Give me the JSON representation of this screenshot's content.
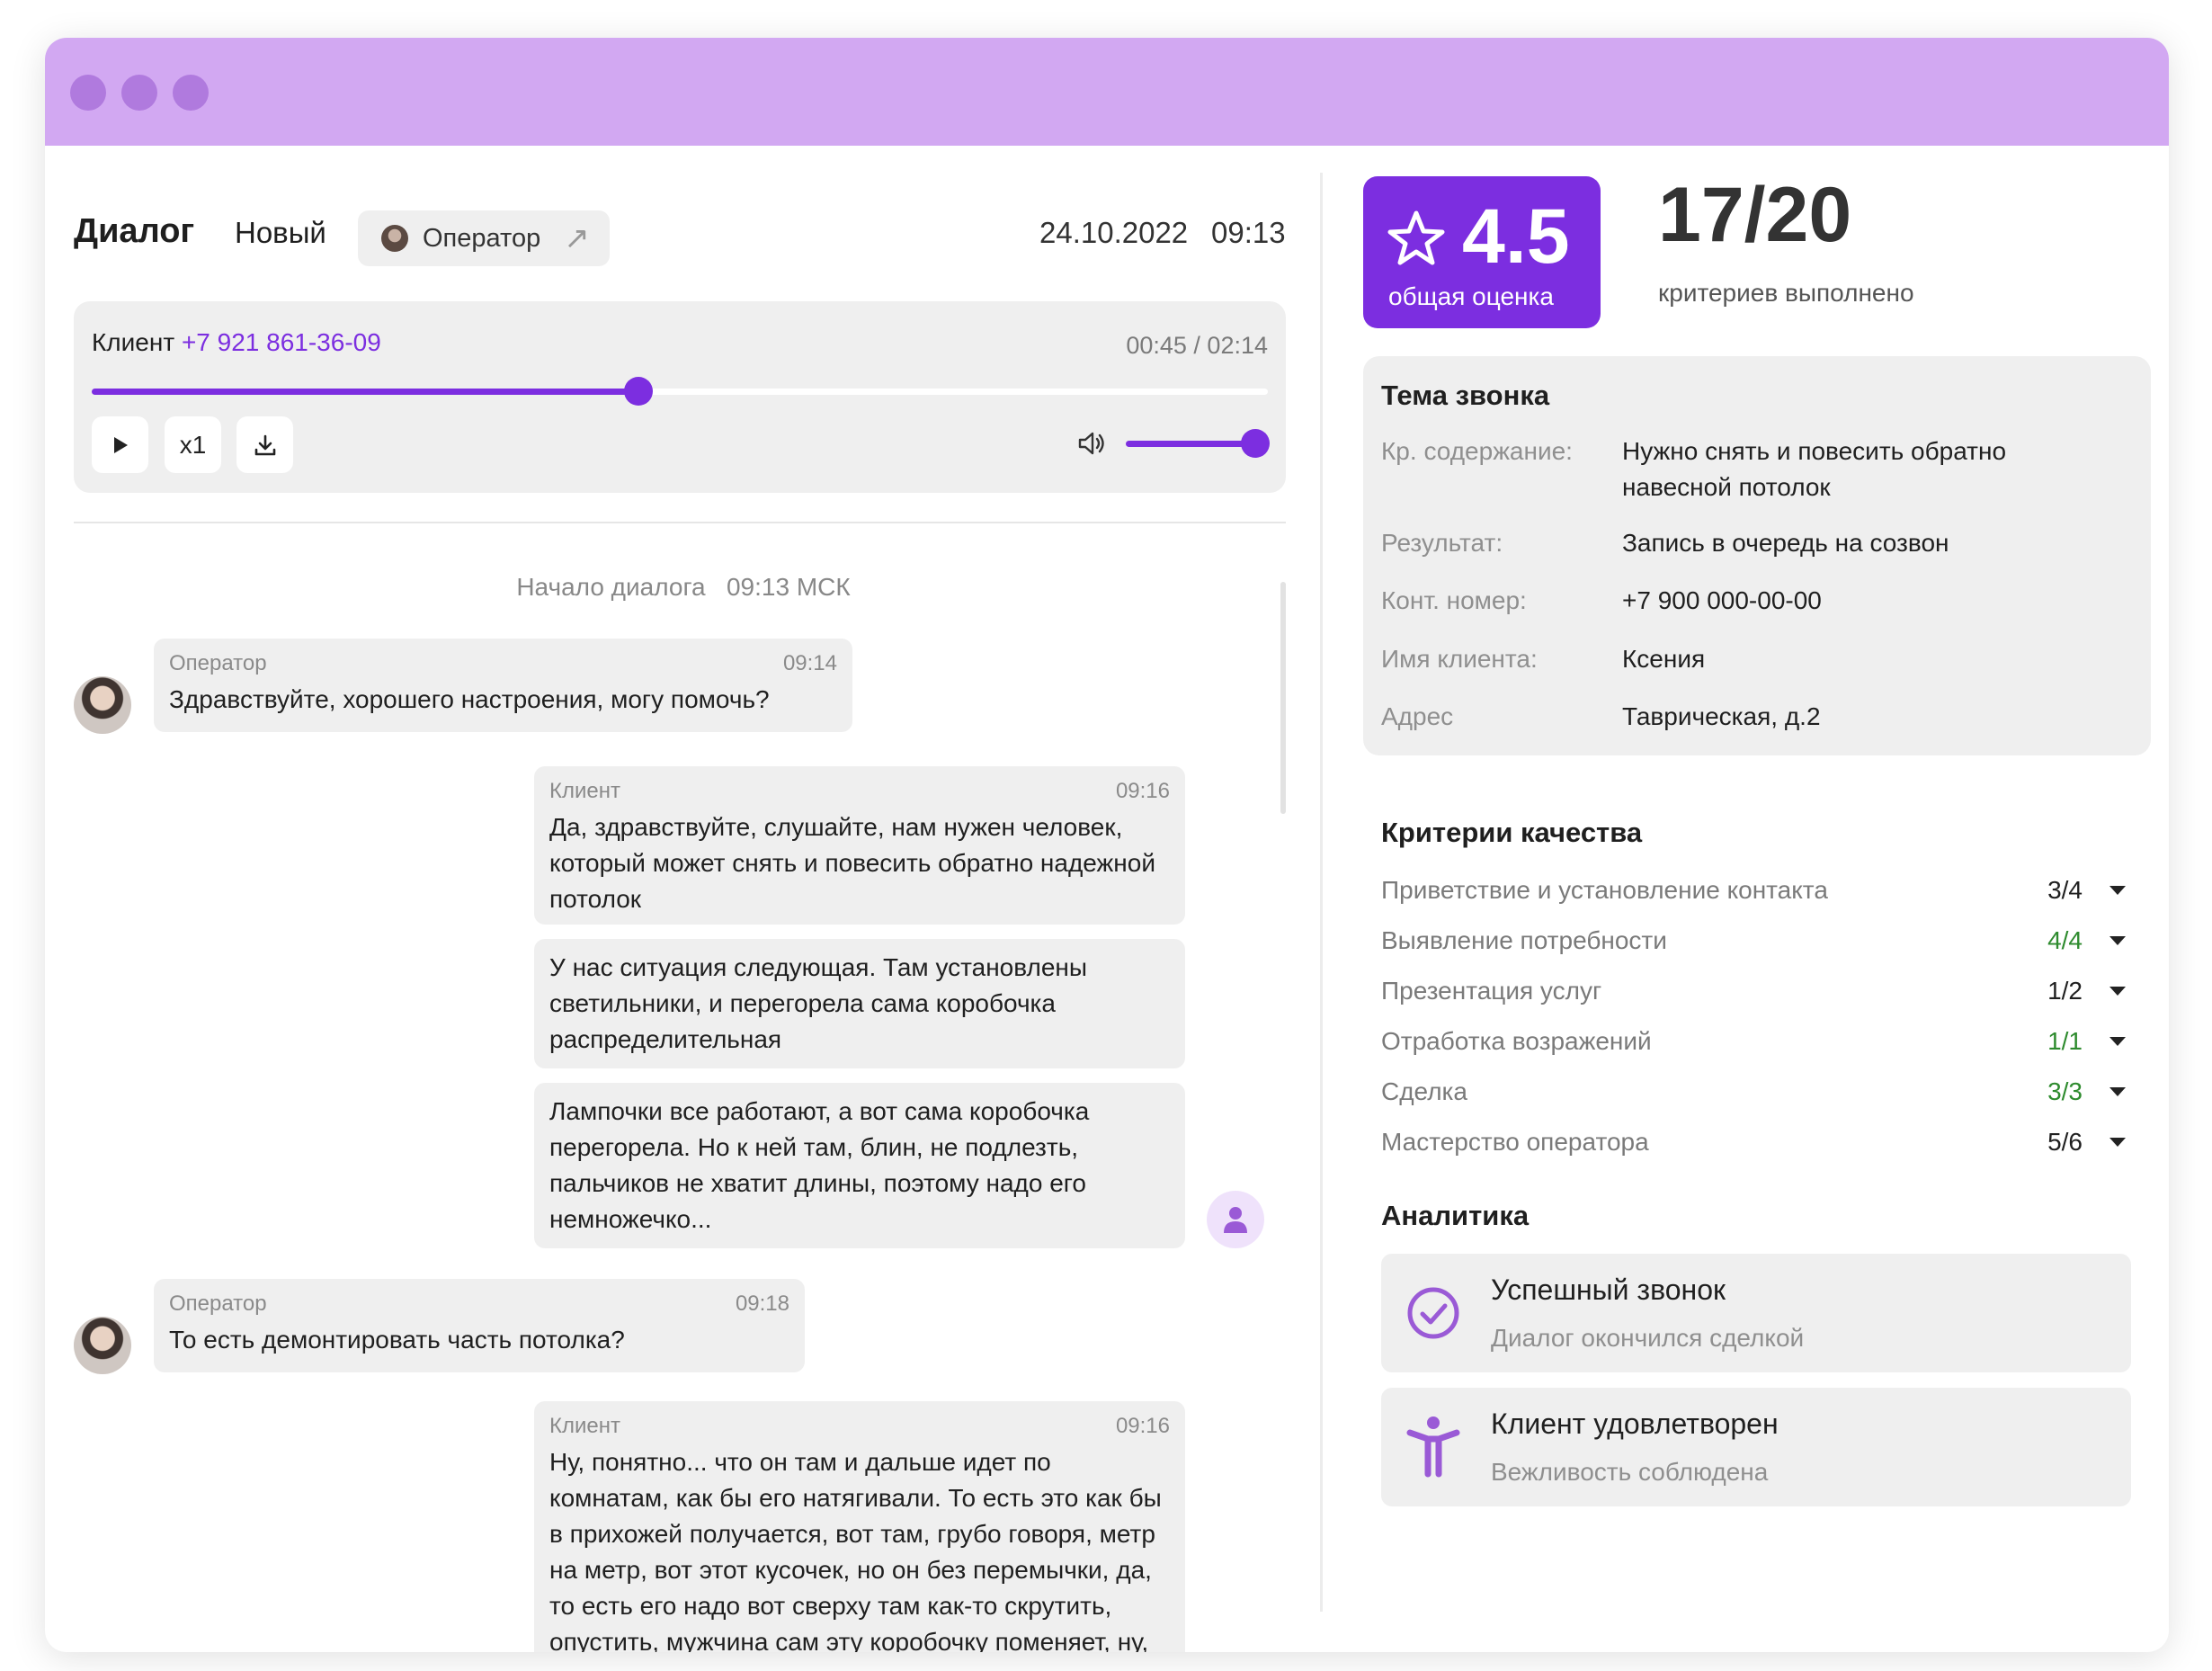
{
  "header": {
    "title": "Диалог",
    "status": "Новый",
    "operator_chip": "Оператор",
    "date": "24.10.2022",
    "time": "09:13"
  },
  "player": {
    "client_label": "Клиент",
    "client_phone": "+7 921 861-36-09",
    "time": "00:45 / 02:14",
    "progress_fraction": 0.465,
    "speed_label": "x1",
    "volume_fraction": 1.0
  },
  "chat": {
    "start_label": "Начало диалога",
    "start_time": "09:13 МСК",
    "messages": [
      {
        "sender": "Оператор",
        "time": "09:14",
        "text": "Здравствуйте, хорошего настроения, могу помочь?"
      },
      {
        "sender": "Клиент",
        "time": "09:16",
        "text": "Да, здравствуйте, слушайте, нам нужен человек, который может снять и повесить обратно надежной потолок"
      },
      {
        "text": "У нас ситуация следующая. Там установлены светильники, и перегорела сама коробочка распределительная"
      },
      {
        "text": "Лампочки все работают, а вот сама коробочка перегорела. Но к ней там, блин, не подлезть, пальчиков не хватит длины, поэтому надо его немножечко..."
      },
      {
        "sender": "Оператор",
        "time": "09:18",
        "text": "То есть демонтировать часть потолка?"
      },
      {
        "sender": "Клиент",
        "time": "09:16",
        "text": "Ну, понятно... что он там и дальше идет по комнатам, как бы его натягивали. То есть это как бы в прихожей получается, вот там, грубо говоря, метр на метр, вот этот кусочек, но он без перемычки, да, то есть его надо вот сверху там как-то скрутить, опустить, мужчина сам эту коробочку поменяет, ну, чтобы лампочки как бы"
      }
    ]
  },
  "score": {
    "value": "4.5",
    "label": "общая оценка",
    "criteria_done": "17/20",
    "criteria_label": "критериев выполнено"
  },
  "topic": {
    "title": "Тема звонка",
    "rows": [
      {
        "label": "Кр. содержание:",
        "value": "Нужно снять и повесить обратно навесной потолок"
      },
      {
        "label": "Результат:",
        "value": "Запись в очередь на созвон"
      },
      {
        "label": "Конт. номер:",
        "value": "+7 900 000-00-00"
      },
      {
        "label": "Имя клиента:",
        "value": "Ксения"
      },
      {
        "label": "Адрес",
        "value": "Таврическая, д.2"
      }
    ]
  },
  "criteria": {
    "title": "Критерии качества",
    "items": [
      {
        "name": "Приветствие и установление контакта",
        "value": "3/4",
        "color": "#1f1f1f"
      },
      {
        "name": "Выявление потребности",
        "value": "4/4",
        "color": "#2e8b2e"
      },
      {
        "name": "Презентация услуг",
        "value": "1/2",
        "color": "#1f1f1f"
      },
      {
        "name": "Отработка возражений",
        "value": "1/1",
        "color": "#2e8b2e"
      },
      {
        "name": "Сделка",
        "value": "3/3",
        "color": "#2e8b2e"
      },
      {
        "name": "Мастерство оператора",
        "value": "5/6",
        "color": "#1f1f1f"
      }
    ]
  },
  "analytics": {
    "title": "Аналитика",
    "items": [
      {
        "title": "Успешный звонок",
        "subtitle": "Диалог окончился сделкой",
        "icon": "check-circle-icon"
      },
      {
        "title": "Клиент удовлетворен",
        "subtitle": "Вежливость соблюдена",
        "icon": "person-arms-up-icon"
      }
    ]
  },
  "colors": {
    "accent": "#7c2ee0",
    "titlebar": "#d2a8f2",
    "success": "#2e8b2e"
  }
}
